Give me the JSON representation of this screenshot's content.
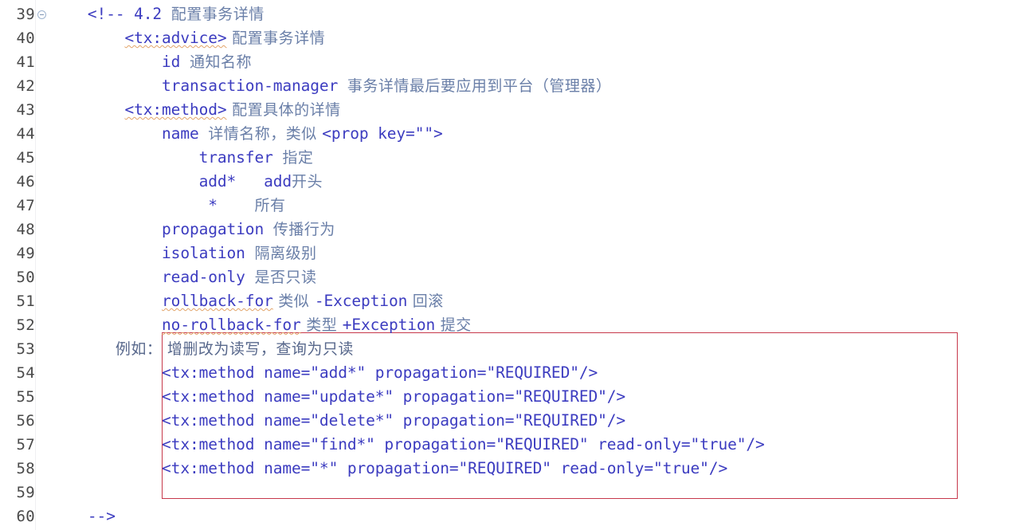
{
  "editor": {
    "language": "xml",
    "colors": {
      "background": "#ffffff",
      "code_text": "#3c3cc0",
      "comment_cn_text": "#6a7fa8",
      "line_number": "#4a4a4a",
      "annotation_border": "#c7384b",
      "squiggle": "#e2a46a"
    },
    "fold_marker_icon": "fold-collapse-icon",
    "lines": [
      {
        "number": "39",
        "fold": true,
        "indent": "   ",
        "segments": [
          {
            "type": "code",
            "text": "<!-- 4.2 "
          },
          {
            "type": "cn",
            "text": "配置事务详情"
          }
        ]
      },
      {
        "number": "40",
        "fold": false,
        "indent": "       ",
        "segments": [
          {
            "type": "code",
            "text": "<tx:advice>",
            "squiggle": true
          },
          {
            "type": "cn",
            "text": " 配置事务详情"
          }
        ]
      },
      {
        "number": "41",
        "fold": false,
        "indent": "           ",
        "segments": [
          {
            "type": "code",
            "text": "id "
          },
          {
            "type": "cn",
            "text": "通知名称"
          }
        ]
      },
      {
        "number": "42",
        "fold": false,
        "indent": "           ",
        "segments": [
          {
            "type": "code",
            "text": "transaction-manager "
          },
          {
            "type": "cn",
            "text": "事务详情最后要应用到平台（管理器）"
          }
        ]
      },
      {
        "number": "43",
        "fold": false,
        "indent": "       ",
        "segments": [
          {
            "type": "code",
            "text": "<tx:method>",
            "squiggle": true
          },
          {
            "type": "cn",
            "text": " 配置具体的详情"
          }
        ]
      },
      {
        "number": "44",
        "fold": false,
        "indent": "           ",
        "segments": [
          {
            "type": "code",
            "text": "name "
          },
          {
            "type": "cn",
            "text": "详情名称，类似 "
          },
          {
            "type": "code",
            "text": "<prop key=\"\">"
          }
        ]
      },
      {
        "number": "45",
        "fold": false,
        "indent": "               ",
        "segments": [
          {
            "type": "code",
            "text": "transfer "
          },
          {
            "type": "cn",
            "text": "指定"
          }
        ]
      },
      {
        "number": "46",
        "fold": false,
        "indent": "               ",
        "segments": [
          {
            "type": "code",
            "text": "add*   add"
          },
          {
            "type": "cn",
            "text": "开头"
          }
        ]
      },
      {
        "number": "47",
        "fold": false,
        "indent": "                ",
        "segments": [
          {
            "type": "code",
            "text": "*    "
          },
          {
            "type": "cn",
            "text": "所有"
          }
        ]
      },
      {
        "number": "48",
        "fold": false,
        "indent": "           ",
        "segments": [
          {
            "type": "code",
            "text": "propagation "
          },
          {
            "type": "cn",
            "text": "传播行为"
          }
        ]
      },
      {
        "number": "49",
        "fold": false,
        "indent": "           ",
        "segments": [
          {
            "type": "code",
            "text": "isolation "
          },
          {
            "type": "cn",
            "text": "隔离级别"
          }
        ]
      },
      {
        "number": "50",
        "fold": false,
        "indent": "           ",
        "segments": [
          {
            "type": "code",
            "text": "read-only "
          },
          {
            "type": "cn",
            "text": "是否只读"
          }
        ]
      },
      {
        "number": "51",
        "fold": false,
        "indent": "           ",
        "segments": [
          {
            "type": "code",
            "text": "rollback-for",
            "squiggle": true
          },
          {
            "type": "cn",
            "text": " 类似 "
          },
          {
            "type": "code",
            "text": "-Exception"
          },
          {
            "type": "cn",
            "text": " 回滚"
          }
        ]
      },
      {
        "number": "52",
        "fold": false,
        "indent": "           ",
        "segments": [
          {
            "type": "code",
            "text": "no-rollback-for",
            "squiggle": true
          },
          {
            "type": "cn",
            "text": " 类型 "
          },
          {
            "type": "code",
            "text": "+Exception"
          },
          {
            "type": "cn",
            "text": " 提交"
          }
        ]
      },
      {
        "number": "53",
        "fold": false,
        "indent": "      ",
        "segments": [
          {
            "type": "cn-dark",
            "text": "例如： 增删改为读写，查询为只读"
          }
        ]
      },
      {
        "number": "54",
        "fold": false,
        "indent": "           ",
        "segments": [
          {
            "type": "code",
            "text": "<tx:method name=\"add*\" propagation=\"REQUIRED\"/>"
          }
        ]
      },
      {
        "number": "55",
        "fold": false,
        "indent": "           ",
        "segments": [
          {
            "type": "code",
            "text": "<tx:method name=\"update*\" propagation=\"REQUIRED\"/>"
          }
        ]
      },
      {
        "number": "56",
        "fold": false,
        "indent": "           ",
        "segments": [
          {
            "type": "code",
            "text": "<tx:method name=\"delete*\" propagation=\"REQUIRED\"/>"
          }
        ]
      },
      {
        "number": "57",
        "fold": false,
        "indent": "           ",
        "segments": [
          {
            "type": "code",
            "text": "<tx:method name=\"find*\" propagation=\"REQUIRED\" read-only=\"true\"/>"
          }
        ]
      },
      {
        "number": "58",
        "fold": false,
        "indent": "           ",
        "segments": [
          {
            "type": "code",
            "text": "<tx:method name=\"*\" propagation=\"REQUIRED\" read-only=\"true\"/>"
          }
        ]
      },
      {
        "number": "59",
        "fold": false,
        "indent": "",
        "segments": []
      },
      {
        "number": "60",
        "fold": false,
        "indent": "   ",
        "segments": [
          {
            "type": "code",
            "text": "-->"
          }
        ]
      }
    ],
    "annotation": {
      "name": "red-highlight-rectangle",
      "covers_lines": [
        "53",
        "54",
        "55",
        "56",
        "57",
        "58",
        "59"
      ]
    }
  }
}
